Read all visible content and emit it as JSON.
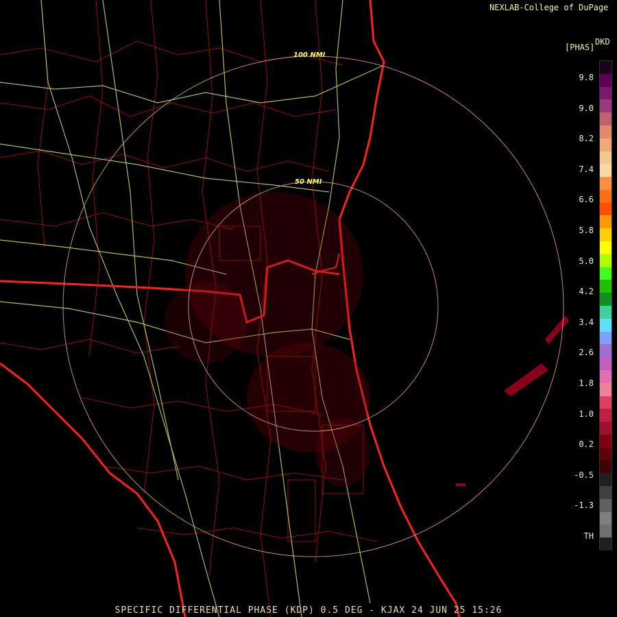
{
  "header": {
    "credit": "NEXLAB-College of DuPage"
  },
  "footer": {
    "caption": "SPECIFIC DIFFERENTIAL PHASE (KDP) 0.5 DEG - KJAX 24 JUN 25 15:26"
  },
  "range_rings": [
    {
      "label": "100 NMI"
    },
    {
      "label": "50 NMI"
    }
  ],
  "legend": {
    "unit": "[PHAS]",
    "product": "DKD",
    "ticks": [
      "9.8",
      "9.0",
      "8.2",
      "7.4",
      "6.6",
      "5.8",
      "5.0",
      "4.2",
      "3.4",
      "2.6",
      "1.8",
      "1.0",
      "0.2",
      "-0.5",
      "-1.3",
      "TH"
    ],
    "colors": [
      "#1a0018",
      "#5a005a",
      "#7a1a6a",
      "#9a3a7a",
      "#c06070",
      "#e08a70",
      "#f0a878",
      "#f4c890",
      "#f8d8a8",
      "#ff9040",
      "#ff7010",
      "#ff5000",
      "#ff9a00",
      "#ffd000",
      "#ffff00",
      "#b0ff00",
      "#40ff20",
      "#20c000",
      "#109020",
      "#40d0a0",
      "#60e0ff",
      "#80a0ff",
      "#a070d0",
      "#c060c0",
      "#e070b0",
      "#f080a0",
      "#e04060",
      "#c02040",
      "#a01030",
      "#800010",
      "#600008",
      "#400005",
      "#202020",
      "#404040",
      "#606060",
      "#808080",
      "#707070",
      "#202020"
    ]
  }
}
